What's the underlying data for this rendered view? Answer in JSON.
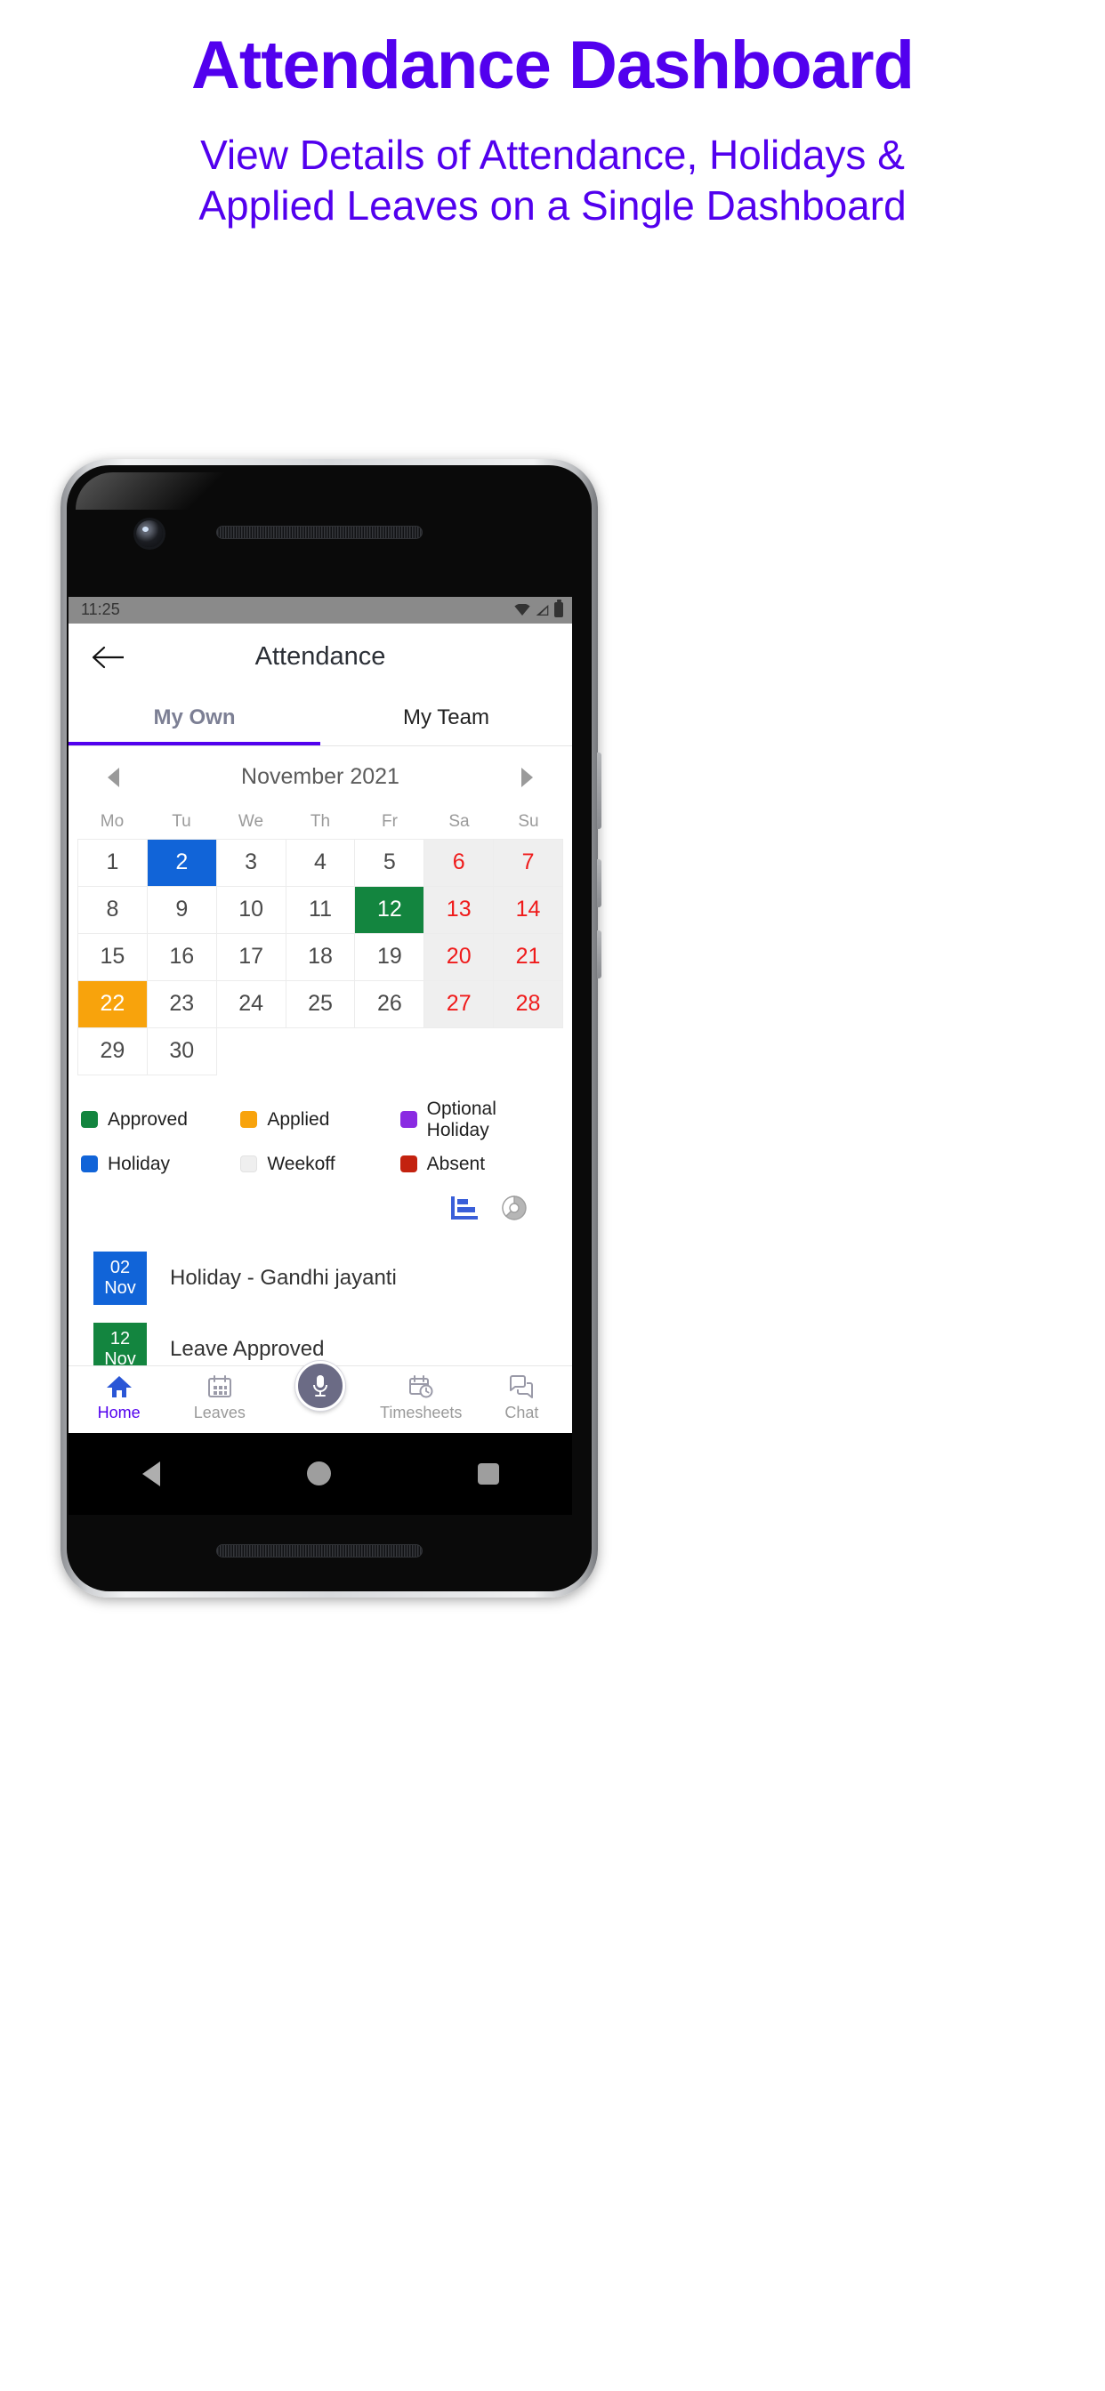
{
  "promo": {
    "title": "Attendance Dashboard",
    "subtitle_line1": "View Details of Attendance, Holidays &",
    "subtitle_line2": "Applied Leaves on a Single Dashboard",
    "accent_color": "#5200ee"
  },
  "statusbar": {
    "time": "11:25",
    "icons": [
      "wifi-icon",
      "signal-icon",
      "battery-icon"
    ]
  },
  "appbar": {
    "title": "Attendance",
    "back_icon": "back-arrow-icon"
  },
  "tabs": [
    {
      "label": "My Own",
      "active": true
    },
    {
      "label": "My Team",
      "active": false
    }
  ],
  "calendar": {
    "month_label": "November 2021",
    "prev_icon": "chevron-left-icon",
    "next_icon": "chevron-right-icon",
    "weekdays": [
      "Mo",
      "Tu",
      "We",
      "Th",
      "Fr",
      "Sa",
      "Su"
    ],
    "weeks": [
      [
        {
          "day": "1",
          "status": "none"
        },
        {
          "day": "2",
          "status": "holiday"
        },
        {
          "day": "3",
          "status": "none"
        },
        {
          "day": "4",
          "status": "none"
        },
        {
          "day": "5",
          "status": "none"
        },
        {
          "day": "6",
          "status": "weekend"
        },
        {
          "day": "7",
          "status": "weekend"
        }
      ],
      [
        {
          "day": "8",
          "status": "none"
        },
        {
          "day": "9",
          "status": "none"
        },
        {
          "day": "10",
          "status": "none"
        },
        {
          "day": "11",
          "status": "none"
        },
        {
          "day": "12",
          "status": "approved"
        },
        {
          "day": "13",
          "status": "weekend"
        },
        {
          "day": "14",
          "status": "weekend"
        }
      ],
      [
        {
          "day": "15",
          "status": "none"
        },
        {
          "day": "16",
          "status": "none"
        },
        {
          "day": "17",
          "status": "none"
        },
        {
          "day": "18",
          "status": "none"
        },
        {
          "day": "19",
          "status": "none"
        },
        {
          "day": "20",
          "status": "weekend"
        },
        {
          "day": "21",
          "status": "weekend"
        }
      ],
      [
        {
          "day": "22",
          "status": "applied"
        },
        {
          "day": "23",
          "status": "none"
        },
        {
          "day": "24",
          "status": "none"
        },
        {
          "day": "25",
          "status": "none"
        },
        {
          "day": "26",
          "status": "none"
        },
        {
          "day": "27",
          "status": "weekend"
        },
        {
          "day": "28",
          "status": "weekend"
        }
      ],
      [
        {
          "day": "29",
          "status": "none"
        },
        {
          "day": "30",
          "status": "none"
        },
        {
          "day": "",
          "status": "empty"
        },
        {
          "day": "",
          "status": "empty"
        },
        {
          "day": "",
          "status": "empty"
        },
        {
          "day": "",
          "status": "empty"
        },
        {
          "day": "",
          "status": "empty"
        }
      ]
    ]
  },
  "legend": [
    {
      "label": "Approved",
      "color": "#13853f"
    },
    {
      "label": "Applied",
      "color": "#f8a30c"
    },
    {
      "label": "Optional Holiday",
      "color": "#8a2be2"
    },
    {
      "label": "Holiday",
      "color": "#1164d8"
    },
    {
      "label": "Weekoff",
      "color": "#efefef"
    },
    {
      "label": "Absent",
      "color": "#c3220f"
    }
  ],
  "chart_toggles": [
    {
      "name": "bar-chart-icon",
      "active": true,
      "color": "#3a5fd9"
    },
    {
      "name": "pie-chart-icon",
      "active": false,
      "color": "#9e9e9e"
    }
  ],
  "events": [
    {
      "day": "02",
      "month": "Nov",
      "color": "blue",
      "text": "Holiday - Gandhi jayanti"
    },
    {
      "day": "12",
      "month": "Nov",
      "color": "green",
      "text": "Leave Approved"
    }
  ],
  "bottom_nav": [
    {
      "label": "Home",
      "icon": "home-icon",
      "active": true
    },
    {
      "label": "Leaves",
      "icon": "calendar-icon",
      "active": false
    },
    {
      "label": "",
      "icon": "microphone-icon",
      "active": false
    },
    {
      "label": "Timesheets",
      "icon": "timesheet-icon",
      "active": false
    },
    {
      "label": "Chat",
      "icon": "chat-icon",
      "active": false
    }
  ],
  "system_nav": {
    "back": "android-back-icon",
    "home": "android-home-icon",
    "recents": "android-recents-icon"
  }
}
